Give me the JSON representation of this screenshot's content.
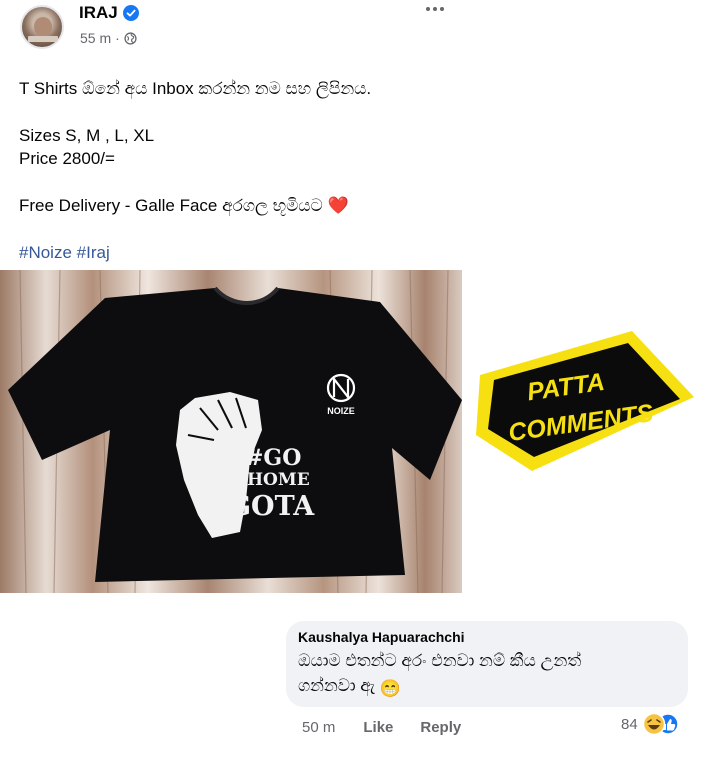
{
  "post": {
    "author": "IRAJ",
    "timestamp": "55 m",
    "meta_sep": "·",
    "lines": [
      "T Shirts ඕනේ අය Inbox කරන්න නම සහ ලිපිනය.",
      "Sizes S, M , L, XL",
      "Price 2800/=",
      "Free Delivery - Galle Face අරගල භූමියට"
    ],
    "hashtags": [
      "#Noize",
      "#Iraj"
    ],
    "heart_emoji": "❤️"
  },
  "image": {
    "shirt_brand": "NOIZE",
    "shirt_text": [
      "#GO",
      "HOME",
      "GOTA"
    ]
  },
  "sticker": {
    "line1": "PATTA",
    "line2": "COMMENTS"
  },
  "comment": {
    "author": "Kaushalya Hapuarachchi",
    "text_line1": "ඔයාම එතන්ට අරං එනවා නම් කීය උනත්",
    "text_line2": "ගන්නවා ඇ",
    "emoji": "😁",
    "time": "50 m",
    "like_label": "Like",
    "reply_label": "Reply",
    "reaction_count": "84"
  },
  "colors": {
    "link": "#385898",
    "verified": "#1877f2",
    "sticker_yellow": "#f7e012",
    "bubble_bg": "#f0f2f5"
  }
}
